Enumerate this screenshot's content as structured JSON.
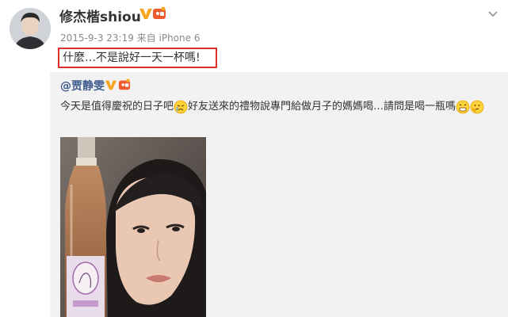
{
  "post": {
    "author": "修杰楷shiou",
    "meta": "2015-9-3 23:19  来自 iPhone 6",
    "text": "什麼…不是說好一天一杯嗎!",
    "highlight_color": "#e0322c"
  },
  "repost": {
    "author": "@贾静雯",
    "text_part1": "今天是值得慶祝的日子吧",
    "text_part2": "好友送來的禮物說專門給做月子的媽媽喝…請問是喝一瓶嗎",
    "link_color": "#3c5a8c"
  },
  "icons": {
    "vip": "verified-v-icon",
    "fan": "fan-badge-icon",
    "dropdown": "chevron-down-icon",
    "emoji1": "crying-emoji",
    "emoji2": "grin-emoji",
    "emoji3": "thinking-emoji"
  },
  "colors": {
    "vip_orange": "#f6a623",
    "meta_gray": "#8a8a8a",
    "repost_bg": "#f2f2f2"
  }
}
